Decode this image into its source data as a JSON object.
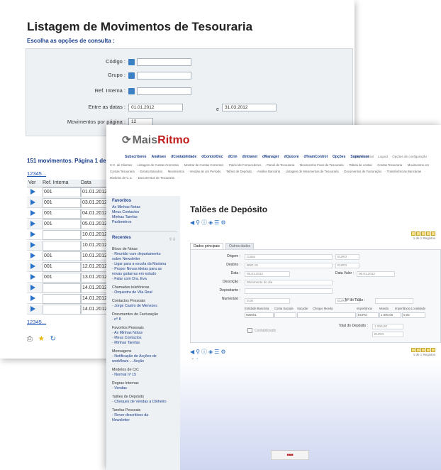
{
  "listing": {
    "title": "Listagem de Movimentos de Tesouraria",
    "subtitle": "Escolha as opções de consulta :",
    "filters": {
      "codigo_label": "Código :",
      "grupo_label": "Grupo :",
      "ref_interna_label": "Ref. Interna :",
      "datas_label": "Entre as datas :",
      "date_from": "01.01.2012",
      "date_separator": "e",
      "date_to": "31.03.2012",
      "per_page_label": "Movimentos por página :",
      "per_page_value": "12"
    },
    "count_text": "151 movimentos. Página 1 de",
    "pager": "12345...",
    "columns": [
      "Ver",
      "Ref. Interna",
      "Data"
    ],
    "rows": [
      {
        "ref": "001",
        "date": "01.01.2012"
      },
      {
        "ref": "001",
        "date": "03.01.2012"
      },
      {
        "ref": "001",
        "date": "04.01.2012"
      },
      {
        "ref": "001",
        "date": "05.01.2012"
      },
      {
        "ref": "",
        "date": "10.01.2012"
      },
      {
        "ref": "",
        "date": "10.01.2012"
      },
      {
        "ref": "001",
        "date": "10.01.2012"
      },
      {
        "ref": "001",
        "date": "12.01.2012"
      },
      {
        "ref": "001",
        "date": "13.01.2012"
      },
      {
        "ref": "",
        "date": "14.01.2012"
      },
      {
        "ref": "",
        "date": "14.01.2012"
      },
      {
        "ref": "",
        "date": "14.01.2012"
      }
    ],
    "pager_bottom": "12345..."
  },
  "app": {
    "logo_mais": "Mais",
    "logo_ritmo": "Ritmo",
    "top_links": [
      "Página Inicial",
      "Logout",
      "Opções de configuração"
    ],
    "menu": [
      "Subscritores",
      "Análises",
      "dContabilidade",
      "dControlDoc",
      "dCrm",
      "dIntranet",
      "dManager",
      "dQuoore",
      "dTeamControl",
      "Opções",
      "Supervisor"
    ],
    "sublinks": [
      "C.C. de Clientes",
      "Listagem de Contas Correntes",
      "Mostrar de Contas Correntes",
      "Painel de Fornecedores",
      "Painel de Tesouraria",
      "Movimentos Fixos de Tesouraria",
      "Tabela de contas",
      "Contas Tesouraria",
      "Movimentos em Contas Tesouraria",
      "Extrato Bancário",
      "Movimentos",
      "Vendas de um Período",
      "Talões de Depósito",
      "Análise Bancária",
      "Listagem de Movimentos de Tesouraria",
      "Documentos de Facturação",
      "Transferências Bancárias",
      "Modelos de C.C.",
      "Documentos de Tesouraria"
    ],
    "sidebar": {
      "favoritos_title": "Favoritos",
      "favoritos_items": [
        "As Minhas Notas",
        "Meus Contactos",
        "Minhas Tarefas",
        "Parâmetros"
      ],
      "recentes_title": "Recentes",
      "recentes_groups": [
        {
          "head": "Bloco de Notas",
          "links": [
            "- Reunião com departamento",
            "sobre Newsletter",
            "- Ligar para a escola da Mariana",
            "- Propor Novas ideias para as",
            "novas guitarras em estudo",
            "- Falar com Dra. Eva"
          ]
        },
        {
          "head": "Chamadas telefónicas",
          "links": [
            "- Orquestra de Vila Real"
          ]
        },
        {
          "head": "Contactos Pessoais",
          "links": [
            "- Jorge Castro de Menezes"
          ]
        },
        {
          "head": "Documentos de Facturação",
          "links": [
            "- nº 8"
          ]
        },
        {
          "head": "Favoritos Pessoais",
          "links": [
            "- As Minhas Notas",
            "- Meus Contactos",
            "- Minhas Tarefas"
          ]
        },
        {
          "head": "Mensagens",
          "links": [
            "- Notificação de Acções de",
            "workflows ... Acção"
          ]
        },
        {
          "head": "Modelos de C/C",
          "links": [
            "- Normal nº 15"
          ]
        },
        {
          "head": "Regras Internas",
          "links": [
            "- Vendas"
          ]
        },
        {
          "head": "Talões de Depósito",
          "links": [
            "- Cheques de Vendas a Dinheiro"
          ]
        },
        {
          "head": "Tarefas Pessoais",
          "links": [
            "- Rever descritivos da",
            "Newsletter"
          ]
        }
      ]
    },
    "form": {
      "title": "Talões de Depósito",
      "pager_info": "1 de 1 Registos",
      "tabs": [
        "Dados principais",
        "Outros dados"
      ],
      "labels": {
        "origem": "Origem :",
        "destino": "Destino :",
        "data": "Data :",
        "descricao": "Descrição :",
        "depositante": "Depositante :",
        "numerario": "Numerário :",
        "data_valor": "Data Valor :",
        "n_talao": "Nº do Talão :",
        "total": "Total do Depósito :",
        "contabilizado": "Contabilizado"
      },
      "values": {
        "origem": "Caixa",
        "origem_cur": "EURO",
        "destino": "BNP 15",
        "destino_cur": "EURO",
        "data": "06.01.2012",
        "data_valor": "06.01.2012",
        "descricao": "Movimento do dia",
        "numerario": "0,00",
        "numerario_cur": "EURO",
        "total": "1.000,00",
        "total_cur": "EURO"
      },
      "grid_headers": [
        "Entidade Bancária",
        "Conta Sacada",
        "Sacador",
        "Cheque Moeda",
        "Importância",
        "Moeda",
        "Importância Localidade"
      ],
      "grid_row": [
        "000001",
        "EURO",
        "1.000,00",
        "0,00"
      ]
    }
  }
}
